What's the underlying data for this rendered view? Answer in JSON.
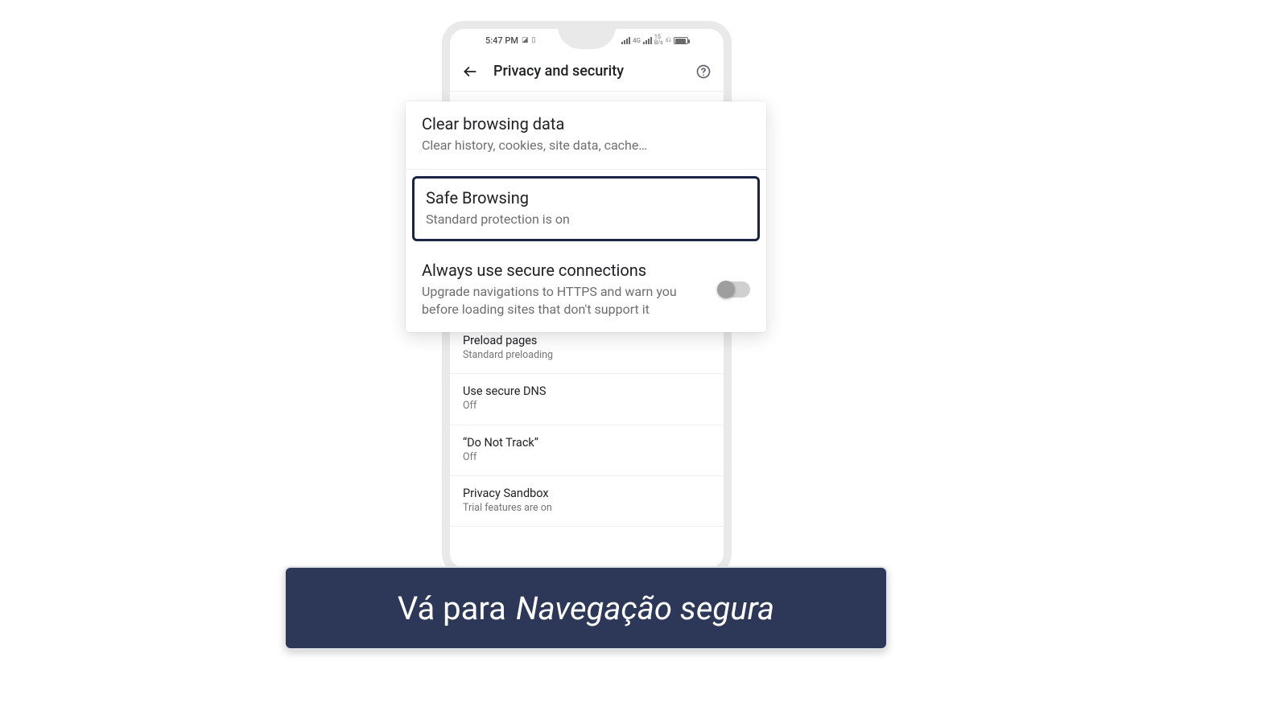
{
  "statusbar": {
    "time": "5:47 PM",
    "net_gen": "4G",
    "net_rate": "15",
    "net_unit": "B/s"
  },
  "header": {
    "title": "Privacy and security"
  },
  "zoom": {
    "clear": {
      "title": "Clear browsing data",
      "sub": "Clear history, cookies, site data, cache…"
    },
    "safe": {
      "title": "Safe Browsing",
      "sub": "Standard protection is on"
    },
    "secure": {
      "title": "Always use secure connections",
      "sub": "Upgrade navigations to HTTPS and warn you before loading sites that don't support it"
    }
  },
  "items": {
    "preload": {
      "title": "Preload pages",
      "sub": "Standard preloading"
    },
    "dns": {
      "title": "Use secure DNS",
      "sub": "Off"
    },
    "dnt": {
      "title": "“Do Not Track”",
      "sub": "Off"
    },
    "sandbox": {
      "title": "Privacy Sandbox",
      "sub": "Trial features are on"
    }
  },
  "caption": {
    "pre": "Vá para",
    "em": "Navegação segura"
  }
}
